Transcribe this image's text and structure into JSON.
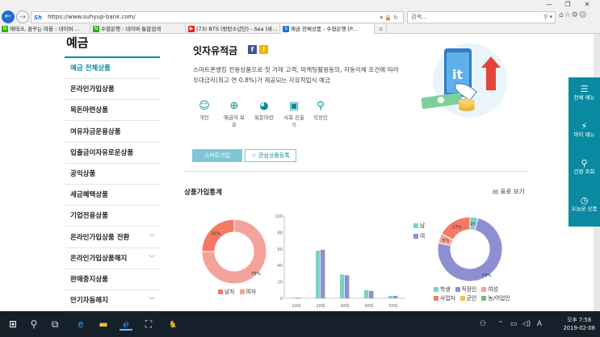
{
  "browser": {
    "url": "https://www.suhyup-bank.com/",
    "url_logo": "Sh",
    "search_placeholder": "검색...",
    "tabs": [
      {
        "label": "재테크, 꿈꾸는 마을 : 네이버 ...",
        "icon_color": "#2db400",
        "icon": "N"
      },
      {
        "label": "수협은행 : 네이버 통합검색",
        "icon_color": "#2db400",
        "icon": "N"
      },
      {
        "label": "(73) BTS (방탄소년단) - Sea (바...",
        "icon_color": "#e62117",
        "icon": "▶"
      },
      {
        "label": "예금 전체상품 - 수협은행 [P...",
        "icon_color": "#1e6fd0",
        "icon": "S"
      }
    ]
  },
  "sidebar": {
    "title": "예금",
    "items": [
      {
        "label": "예금 전체상품",
        "active": true,
        "chevron": false
      },
      {
        "label": "온라인가입상품",
        "active": false,
        "chevron": false
      },
      {
        "label": "목돈마련상품",
        "active": false,
        "chevron": false
      },
      {
        "label": "여유자금운용상품",
        "active": false,
        "chevron": false
      },
      {
        "label": "입출금이자유로운상품",
        "active": false,
        "chevron": false
      },
      {
        "label": "공익상품",
        "active": false,
        "chevron": false
      },
      {
        "label": "세금혜택상품",
        "active": false,
        "chevron": false
      },
      {
        "label": "기업전용상품",
        "active": false,
        "chevron": false
      },
      {
        "label": "온라인가입상품 전환",
        "active": false,
        "chevron": true
      },
      {
        "label": "온라인가입상품해지",
        "active": false,
        "chevron": true
      },
      {
        "label": "판매중지상품",
        "active": false,
        "chevron": false
      },
      {
        "label": "만기자동해지",
        "active": false,
        "chevron": true
      }
    ]
  },
  "product": {
    "title": "잇자유적금",
    "desc": "스마트폰뱅킹 전용상품으로 첫 거래 고객, 마케팅활용동의, 자동이체 조건에 따라 우대금리(최고 연 0.8%)가 제공되는 자유적립식 예금",
    "targets": [
      {
        "icon": "☺",
        "label": "개인"
      },
      {
        "icon": "⊕",
        "label": "예금자 보호"
      },
      {
        "icon": "◕",
        "label": "목돈마련"
      },
      {
        "icon": "▣",
        "label": "사회 진출기"
      },
      {
        "icon": "⚲",
        "label": "직장인"
      }
    ],
    "btn_smart": "스마트가입",
    "btn_fav": "관심상품등록",
    "hero_text": "it"
  },
  "stats": {
    "title": "상품가입통계",
    "table_view": "표로 보기"
  },
  "colors": {
    "teal": "#0a8aa0",
    "salmon": "#f4a39a",
    "orange_red": "#f47a63",
    "lilac": "#8e8fd2",
    "mint": "#7fd0c4"
  },
  "chart_data": [
    {
      "type": "pie",
      "variant": "donut",
      "labels": [
        "남자",
        "여자"
      ],
      "values": [
        25,
        75
      ],
      "value_labels": [
        "25%",
        "75%"
      ],
      "colors": [
        "#f47a63",
        "#f4a39a"
      ],
      "legend": "bottom"
    },
    {
      "type": "bar",
      "categories": [
        "10대",
        "20대",
        "30대",
        "40대",
        "50대"
      ],
      "series": [
        {
          "name": "남",
          "values": [
            0,
            58,
            29,
            10,
            3
          ],
          "color": "#7fd0c4"
        },
        {
          "name": "여",
          "values": [
            0,
            59,
            28,
            9,
            3
          ],
          "color": "#8e8fd2"
        }
      ],
      "ylim": [
        0,
        100
      ],
      "yticks": [
        0,
        20,
        40,
        60,
        80,
        100
      ],
      "legend": "top-right",
      "grid": false
    },
    {
      "type": "pie",
      "variant": "donut",
      "labels": [
        "학생",
        "직장인",
        "여성",
        "사업자",
        "군인",
        "농/어업인"
      ],
      "values": [
        4,
        74,
        5,
        17,
        0,
        0
      ],
      "value_labels": [
        "4%",
        "74%",
        "5%",
        "17%",
        "",
        ""
      ],
      "colors": [
        "#7fd0c4",
        "#8e8fd2",
        "#f4a39a",
        "#f47a63",
        "#f2c14e",
        "#6fbf6f"
      ],
      "legend": "bottom"
    }
  ],
  "floatmenu": [
    {
      "icon": "☰",
      "label": "전체 메뉴"
    },
    {
      "icon": "⚡",
      "label": "마이 메뉴"
    },
    {
      "icon": "⚲",
      "label": "간편 조회"
    },
    {
      "icon": "◷",
      "label": "오늘본 상품"
    }
  ],
  "taskbar": {
    "time": "오후 7:58",
    "date": "2019-02-08"
  }
}
